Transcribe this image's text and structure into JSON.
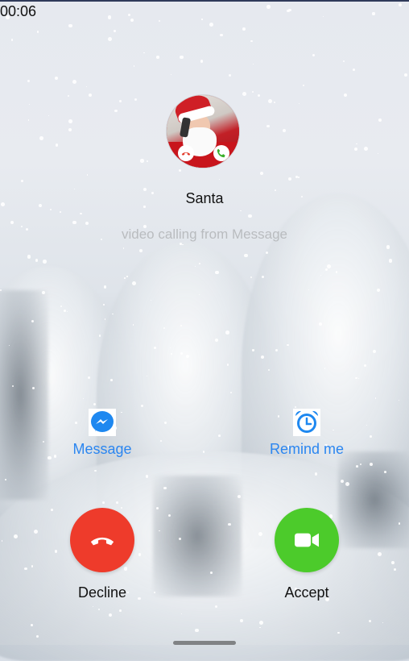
{
  "status": {
    "time": "00:06"
  },
  "caller": {
    "name": "Santa",
    "subtitle": "video calling from Message"
  },
  "actions": {
    "message": {
      "label": "Message",
      "icon": "messenger-icon"
    },
    "remind": {
      "label": "Remind me",
      "icon": "alarm-clock-icon"
    }
  },
  "buttons": {
    "decline": {
      "label": "Decline",
      "color": "#ee3b2b",
      "icon": "phone-hangup-icon"
    },
    "accept": {
      "label": "Accept",
      "color": "#4ccb2b",
      "icon": "video-camera-icon"
    }
  },
  "colors": {
    "accent": "#2b86f0"
  }
}
